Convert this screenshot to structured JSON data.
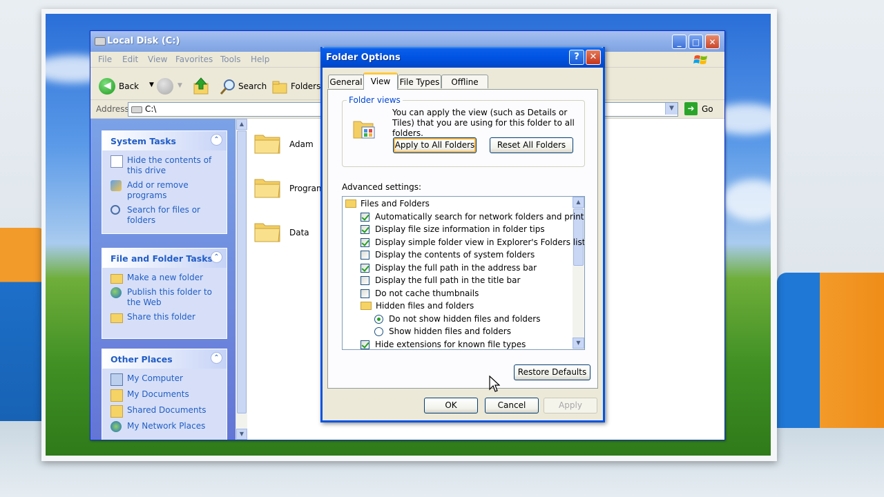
{
  "explorer": {
    "title": "Local Disk (C:)",
    "menu": [
      "File",
      "Edit",
      "View",
      "Favorites",
      "Tools",
      "Help"
    ],
    "toolbar": {
      "back": "Back",
      "search": "Search",
      "folders": "Folders"
    },
    "address": {
      "label": "Address",
      "value": "C:\\",
      "go": "Go"
    },
    "system_tasks": {
      "title": "System Tasks",
      "items": [
        "Hide the contents of this drive",
        "Add or remove programs",
        "Search for files or folders"
      ]
    },
    "file_tasks": {
      "title": "File and Folder Tasks",
      "items": [
        "Make a new folder",
        "Publish this folder to the Web",
        "Share this folder"
      ]
    },
    "other_places": {
      "title": "Other Places",
      "items": [
        "My Computer",
        "My Documents",
        "Shared Documents",
        "My Network Places"
      ]
    },
    "folders": [
      "Adam",
      "Program",
      "Data"
    ]
  },
  "dialog": {
    "title": "Folder Options",
    "tabs": [
      "General",
      "View",
      "File Types",
      "Offline Files"
    ],
    "active_tab": "View",
    "folder_views": {
      "legend": "Folder views",
      "description": "You can apply the view (such as Details or Tiles) that you are using for this folder to all folders.",
      "apply_all": "Apply to All Folders",
      "reset_all": "Reset All Folders"
    },
    "advanced_label": "Advanced settings:",
    "advanced_items": [
      {
        "type": "folder",
        "label": "Files and Folders",
        "level": 0
      },
      {
        "type": "checkbox",
        "label": "Automatically search for network folders and printers",
        "checked": true,
        "level": 1
      },
      {
        "type": "checkbox",
        "label": "Display file size information in folder tips",
        "checked": true,
        "level": 1
      },
      {
        "type": "checkbox",
        "label": "Display simple folder view in Explorer's Folders list",
        "checked": true,
        "level": 1
      },
      {
        "type": "checkbox",
        "label": "Display the contents of system folders",
        "checked": false,
        "level": 1
      },
      {
        "type": "checkbox",
        "label": "Display the full path in the address bar",
        "checked": true,
        "level": 1
      },
      {
        "type": "checkbox",
        "label": "Display the full path in the title bar",
        "checked": false,
        "level": 1
      },
      {
        "type": "checkbox",
        "label": "Do not cache thumbnails",
        "checked": false,
        "level": 1
      },
      {
        "type": "folder",
        "label": "Hidden files and folders",
        "level": 1
      },
      {
        "type": "radio",
        "label": "Do not show hidden files and folders",
        "checked": true,
        "level": 2
      },
      {
        "type": "radio",
        "label": "Show hidden files and folders",
        "checked": false,
        "level": 2
      },
      {
        "type": "checkbox",
        "label": "Hide extensions for known file types",
        "checked": true,
        "level": 1
      }
    ],
    "restore_defaults": "Restore Defaults",
    "ok": "OK",
    "cancel": "Cancel",
    "apply": "Apply"
  },
  "colors": {
    "xp_blue": "#0054e3",
    "task_link": "#215dc6",
    "check_green": "#21a121"
  }
}
